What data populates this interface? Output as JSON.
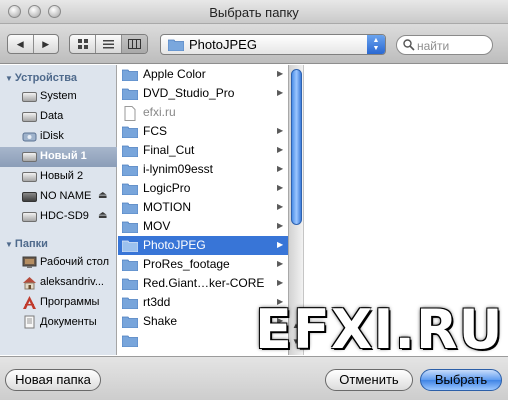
{
  "window": {
    "title": "Выбрать папку"
  },
  "toolbar": {
    "path_value": "PhotoJPEG",
    "search_placeholder": "найти",
    "view_modes": [
      "icon-view",
      "list-view",
      "column-view"
    ],
    "active_view": "column-view"
  },
  "sidebar": {
    "devices_header": "Устройства",
    "devices": [
      {
        "label": "System",
        "icon": "hard-disk-icon",
        "selected": false,
        "eject": false
      },
      {
        "label": "Data",
        "icon": "hard-disk-icon",
        "selected": false,
        "eject": false
      },
      {
        "label": "iDisk",
        "icon": "idisk-icon",
        "selected": false,
        "eject": false
      },
      {
        "label": "Новый 1",
        "icon": "hard-disk-icon",
        "selected": true,
        "eject": false
      },
      {
        "label": "Новый 2",
        "icon": "hard-disk-icon",
        "selected": false,
        "eject": false
      },
      {
        "label": "NO NAME",
        "icon": "external-disk-icon",
        "selected": false,
        "eject": true
      },
      {
        "label": "HDC-SD9",
        "icon": "external-disk-icon",
        "selected": false,
        "eject": true
      }
    ],
    "places_header": "Папки",
    "places": [
      {
        "label": "Рабочий стол",
        "icon": "desktop-icon"
      },
      {
        "label": "aleksandriv...",
        "icon": "home-icon"
      },
      {
        "label": "Программы",
        "icon": "applications-icon"
      },
      {
        "label": "Документы",
        "icon": "documents-icon"
      }
    ]
  },
  "column": {
    "items": [
      {
        "name": "Apple Color",
        "type": "folder",
        "has_children": true,
        "selected": false
      },
      {
        "name": "DVD_Studio_Pro",
        "type": "folder",
        "has_children": true,
        "selected": false
      },
      {
        "name": "efxi.ru",
        "type": "file",
        "has_children": false,
        "selected": false
      },
      {
        "name": "FCS",
        "type": "folder",
        "has_children": true,
        "selected": false
      },
      {
        "name": "Final_Cut",
        "type": "folder",
        "has_children": true,
        "selected": false
      },
      {
        "name": "i-lynim09esst",
        "type": "folder",
        "has_children": true,
        "selected": false
      },
      {
        "name": "LogicPro",
        "type": "folder",
        "has_children": true,
        "selected": false
      },
      {
        "name": "MOTION",
        "type": "folder",
        "has_children": true,
        "selected": false
      },
      {
        "name": "MOV",
        "type": "folder",
        "has_children": true,
        "selected": false
      },
      {
        "name": "PhotoJPEG",
        "type": "folder",
        "has_children": true,
        "selected": true
      },
      {
        "name": "ProRes_footage",
        "type": "folder",
        "has_children": true,
        "selected": false
      },
      {
        "name": "Red.Giant…ker-CORE",
        "type": "folder",
        "has_children": true,
        "selected": false
      },
      {
        "name": "rt3dd",
        "type": "folder",
        "has_children": true,
        "selected": false
      },
      {
        "name": "Shake",
        "type": "folder",
        "has_children": true,
        "selected": false
      }
    ]
  },
  "watermark": "EFXI.RU",
  "buttons": {
    "new_folder": "Новая папка",
    "cancel": "Отменить",
    "choose": "Выбрать"
  },
  "colors": {
    "selection": "#3875d7",
    "folder": "#78a5db",
    "sidebar_bg": "#dde4ed",
    "sidebar_header": "#4f6a8c"
  }
}
